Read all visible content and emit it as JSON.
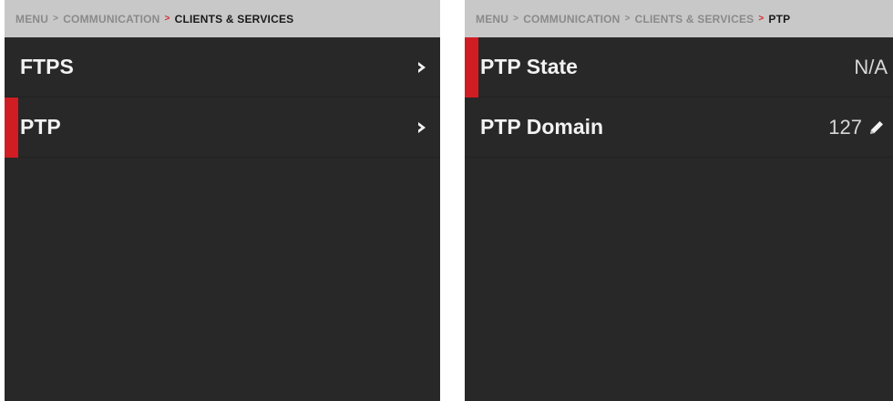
{
  "left_panel": {
    "breadcrumb": {
      "items": [
        "MENU",
        "COMMUNICATION",
        "CLIENTS & SERVICES"
      ],
      "separator": ">"
    },
    "rows": [
      {
        "label": "FTPS",
        "icon": "chevron-right-icon",
        "selected": false
      },
      {
        "label": "PTP",
        "icon": "chevron-right-icon",
        "selected": true
      }
    ]
  },
  "right_panel": {
    "breadcrumb": {
      "items": [
        "MENU",
        "COMMUNICATION",
        "CLIENTS & SERVICES",
        "PTP"
      ],
      "separator": ">"
    },
    "rows": [
      {
        "label": "PTP State",
        "value": "N/A",
        "selected": true
      },
      {
        "label": "PTP Domain",
        "value": "127",
        "icon": "pencil-icon",
        "selected": false
      }
    ]
  },
  "colors": {
    "accent": "#d01d24",
    "panel_bg": "#282828",
    "breadcrumb_bg": "#c8c8c8"
  }
}
